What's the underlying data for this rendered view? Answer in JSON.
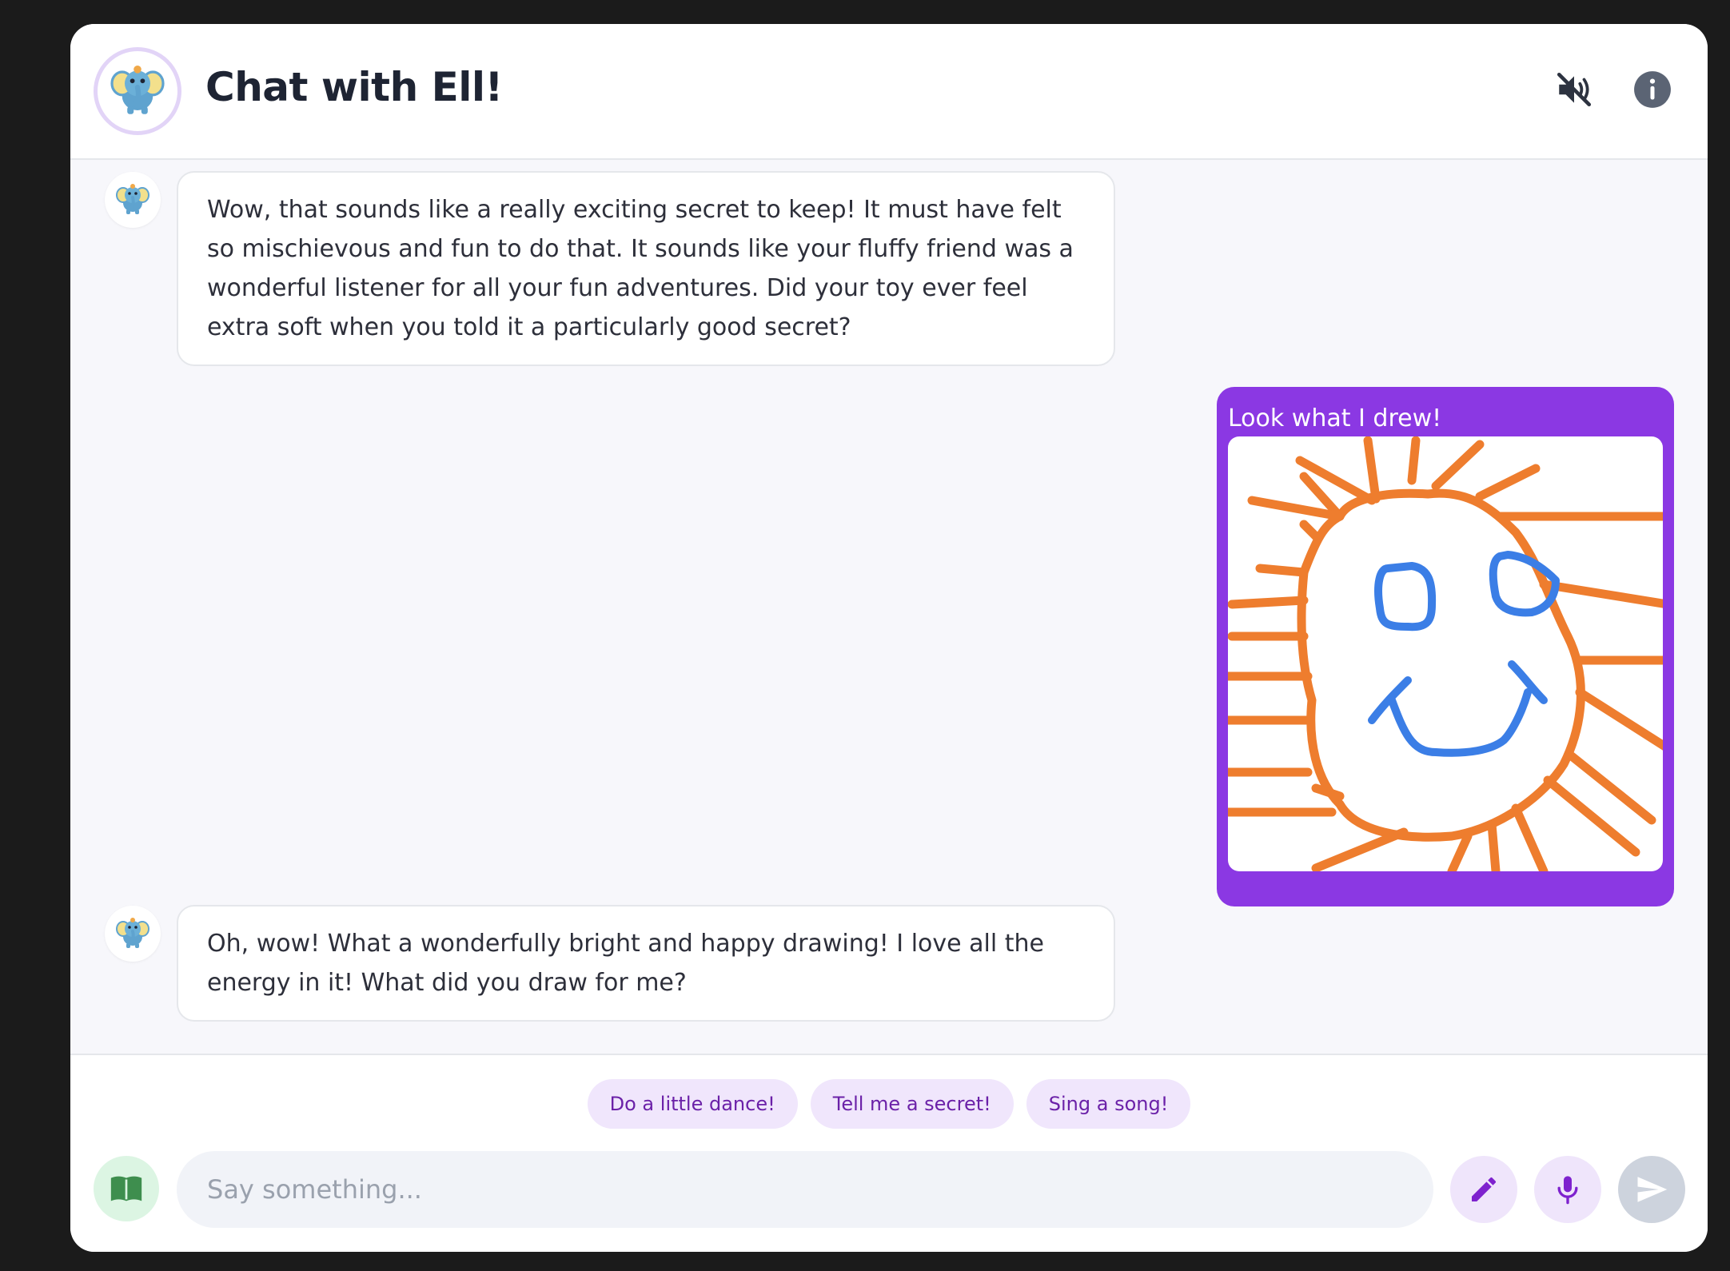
{
  "header": {
    "title": "Chat with Ell!"
  },
  "messages": [
    {
      "role": "bot",
      "text": "Wow, that sounds like a really exciting secret to keep! It must have felt so mischievous and fun to do that. It sounds like your fluffy friend was a wonderful listener for all your fun adventures. Did your toy ever feel extra soft when you told it a particularly good secret?"
    },
    {
      "role": "user",
      "text": "Look what I drew!",
      "attachment": "drawing"
    },
    {
      "role": "bot",
      "text": "Oh, wow! What a wonderfully bright and happy drawing! I love all the energy in it! What did you draw for me?"
    }
  ],
  "suggestions": [
    "Do a little dance!",
    "Tell me a secret!",
    "Sing a song!"
  ],
  "composer": {
    "placeholder": "Say something..."
  },
  "colors": {
    "accent": "#8b38e3",
    "chip_bg": "#f0e6fc",
    "chip_text": "#6b21a8",
    "sun_orange": "#ee7d2e",
    "face_blue": "#3b7ee6"
  },
  "icons": {
    "header_avatar": "elephant-icon",
    "mute": "speaker-muted-icon",
    "info": "info-icon",
    "book": "book-icon",
    "pencil": "pencil-icon",
    "mic": "microphone-icon",
    "send": "send-icon"
  }
}
